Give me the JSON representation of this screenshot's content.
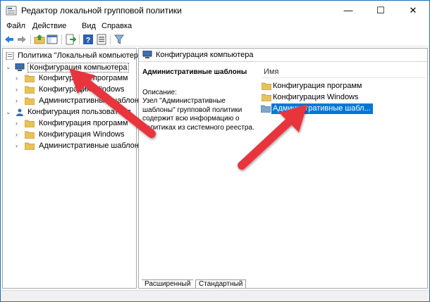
{
  "window": {
    "title": "Редактор локальной групповой политики",
    "controls": {
      "minimize": "—",
      "maximize": "☐",
      "close": "✕"
    }
  },
  "menu": [
    "Файл",
    "Действие",
    "Вид",
    "Справка"
  ],
  "toolbar": {
    "icons": [
      "back-arrow-icon",
      "forward-arrow-icon",
      "up-folder-icon",
      "show-hide-tree-icon",
      "export-list-icon",
      "help-icon",
      "properties-icon",
      "filter-icon"
    ]
  },
  "tree": {
    "root": "Политика \"Локальный компьютер\"",
    "computer_config": "Конфигурация компьютера",
    "computer_children": [
      "Конфигурация программ",
      "Конфигурация Windows",
      "Административные шаблоны"
    ],
    "user_config": "Конфигурация пользователя",
    "user_children": [
      "Конфигурация программ",
      "Конфигурация Windows",
      "Административные шаблоны"
    ]
  },
  "right": {
    "header": "Конфигурация компьютера",
    "desc_title": "Административные шаблоны",
    "desc_label": "Описание:",
    "desc_text": "Узел \"Административные шаблоны\" групповой политики содержит всю информацию о политиках из системного реестра.",
    "column_name": "Имя",
    "items": [
      "Конфигурация программ",
      "Конфигурация Windows",
      "Административные шабл..."
    ]
  },
  "tabs": [
    "Расширенный",
    "Стандартный"
  ],
  "colors": {
    "selection": "#0078d7",
    "folder": "#e8c25a",
    "arrow": "#e8343c"
  }
}
